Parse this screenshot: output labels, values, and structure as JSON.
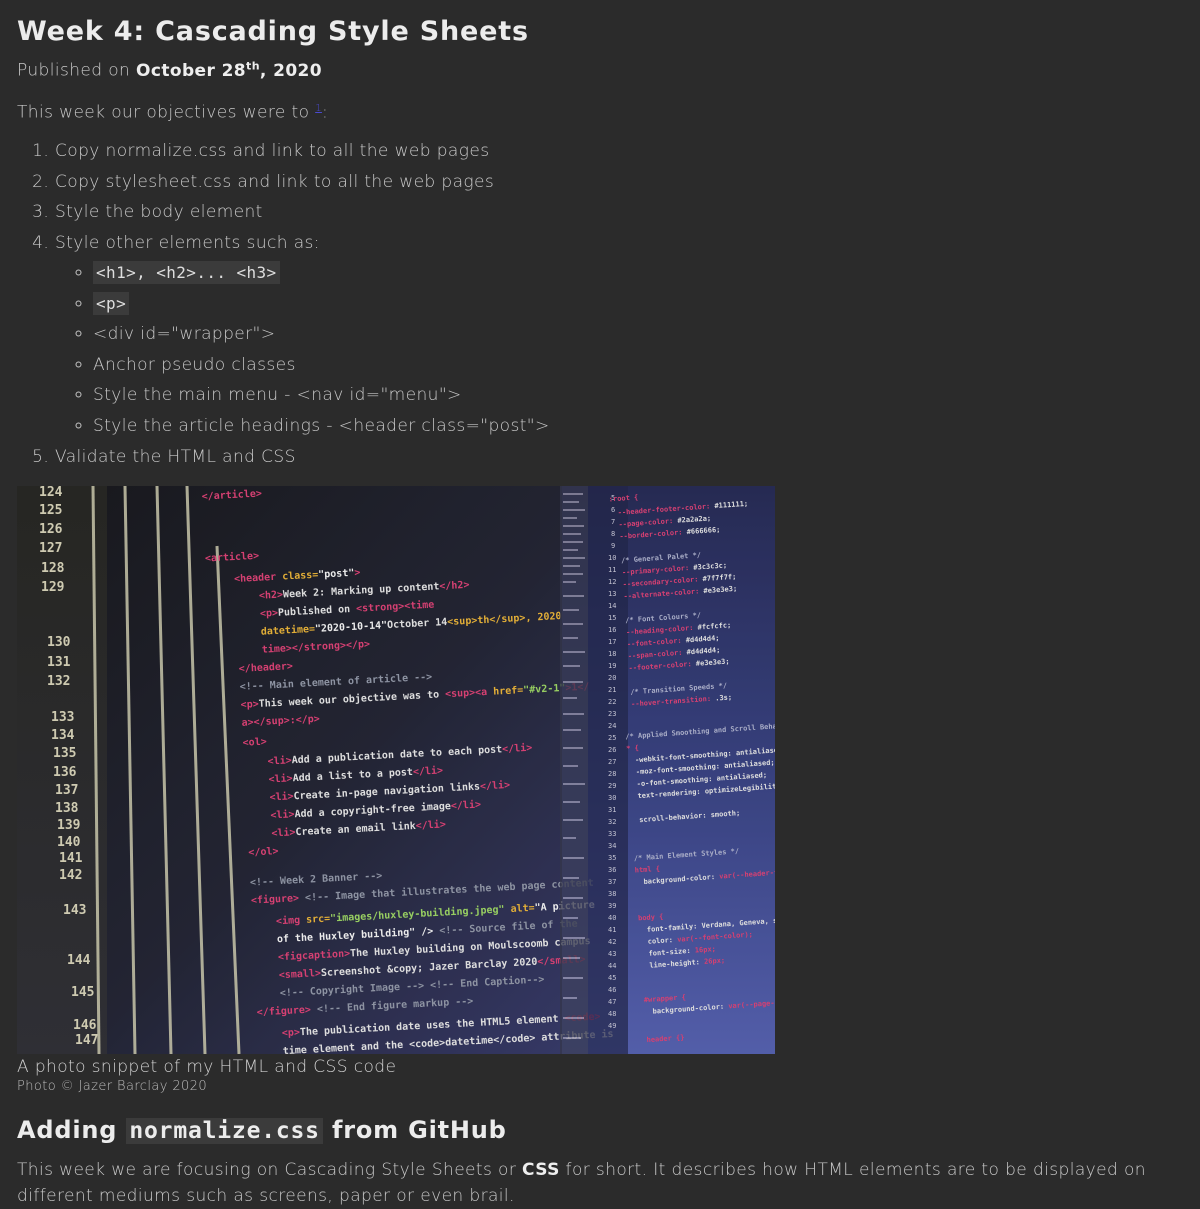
{
  "article": {
    "title": "Week 4: Cascading Style Sheets",
    "published_prefix": "Published on ",
    "published_date_day": "October 28",
    "published_date_sup": "th",
    "published_date_year": ", 2020",
    "intro_text": "This week our objectives were to ",
    "intro_footnote": "1",
    "intro_suffix": ":"
  },
  "objectives": [
    "Copy normalize.css and link to all the web pages",
    "Copy stylesheet.css and link to all the web pages",
    "Style the body element",
    "Style other elements such as:",
    "Validate the HTML and CSS"
  ],
  "sub_objectives": [
    "<h1>, <h2>... <h3>",
    "<p>",
    "<div id=\"wrapper\">",
    "Anchor pseudo classes",
    "Style the main menu - <nav id=\"menu\">",
    "Style the article headings - <header class=\"post\">"
  ],
  "figure": {
    "caption": "A photo snippet of my HTML and CSS code",
    "credit": "Photo © Jazer Barclay 2020"
  },
  "section": {
    "heading_prefix": "Adding ",
    "heading_code": "normalize.css",
    "heading_suffix": " from GitHub",
    "para_start": "This week we are focusing on Cascading Style Sheets or ",
    "para_strong": "CSS",
    "para_end": " for short. It describes how HTML elements are to be displayed on different mediums such as screens, paper or even brail."
  },
  "colors": {
    "background": "#2b2b2b",
    "text": "#c8c8c8",
    "heading": "#ececec",
    "code_bg": "#3b3b3b",
    "link": "#4a4ad0"
  }
}
